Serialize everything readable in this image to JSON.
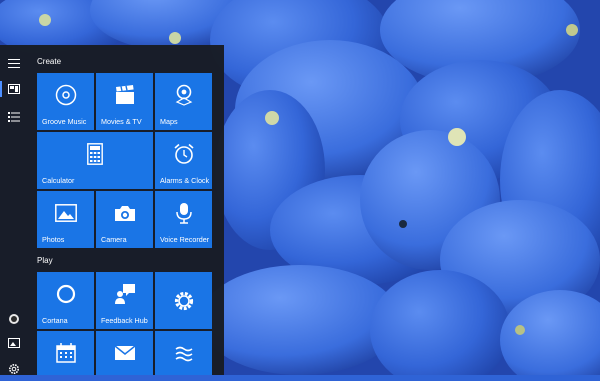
{
  "colors": {
    "tile": "#1a75e6",
    "menu_bg": "#181c24",
    "accent": "#4d8fff",
    "wallpaper": "#2f63d6"
  },
  "rail": {
    "top_icons": [
      "hamburger-icon",
      "tiles-icon",
      "list-icon"
    ],
    "bottom_icons": [
      "account-icon",
      "photos-icon",
      "settings-icon"
    ]
  },
  "groups": {
    "create": "Create",
    "play": "Play"
  },
  "tiles": {
    "groove": "Groove Music",
    "movies": "Movies & TV",
    "maps": "Maps",
    "calculator": "Calculator",
    "alarms": "Alarms & Clock",
    "photos": "Photos",
    "camera": "Camera",
    "voice": "Voice Recorder",
    "cortana": "Cortana",
    "feedback": "Feedback Hub",
    "settings": "",
    "calendar": "",
    "mail": "",
    "weather": ""
  }
}
